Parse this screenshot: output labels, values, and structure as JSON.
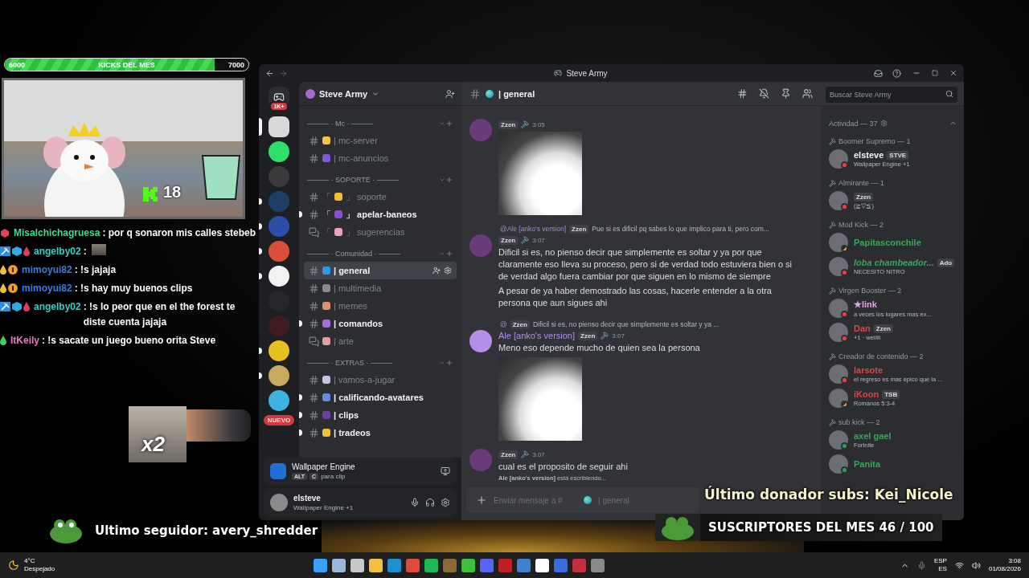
{
  "stream": {
    "goal": {
      "start": "6000",
      "title": "KICKS DEL MES",
      "end": "7000",
      "level": 0.86
    },
    "scene": {
      "counter": "18"
    },
    "chat": [
      {
        "badges": [
          {
            "kind": "gift"
          }
        ],
        "user": "Misalchichagruesa",
        "color": "#3ddc97",
        "text": ": por q sonaron mis calles stebeb",
        "attachment": false
      },
      {
        "badges": [
          {
            "kind": "pickaxe"
          },
          {
            "kind": "cube"
          },
          {
            "kind": "drop"
          }
        ],
        "user": "angelby02",
        "color": "#35d0c5",
        "text": ":",
        "attachment": true
      },
      {
        "badges": [
          {
            "kind": "flame"
          },
          {
            "kind": "coin"
          }
        ],
        "user": "mimoyui82",
        "color": "#3b7ddd",
        "text": ": !s jajaja",
        "attachment": false
      },
      {
        "badges": [
          {
            "kind": "flame"
          },
          {
            "kind": "coin"
          }
        ],
        "user": "mimoyui82",
        "color": "#3b7ddd",
        "text": ": !s hay muy buenos clips",
        "attachment": false
      },
      {
        "badges": [
          {
            "kind": "pickaxe"
          },
          {
            "kind": "cube"
          },
          {
            "kind": "drop"
          }
        ],
        "user": "angelby02",
        "color": "#35d0c5",
        "text": ": !s lo peor que en el the forest te diste cuenta jajaja",
        "attachment": false
      },
      {
        "badges": [
          {
            "kind": "leaf"
          }
        ],
        "user": "ItKeily",
        "color": "#e879c9",
        "text": ": !s sacate un juego bueno orita Steve",
        "attachment": false
      }
    ],
    "clip": {
      "label": "x2"
    },
    "follower": "Ultimo seguidor: avery_shredder",
    "donor": "Último donador subs: Kei_Nicole",
    "subs": "SUSCRIPTORES DEL MES 46 / 100"
  },
  "discord": {
    "window_title": "Steve Army",
    "home_badge": "1K+",
    "servers": [
      {
        "color": "#d9d9d9",
        "selected": true,
        "unread": false
      },
      {
        "color": "#2ee06b",
        "selected": false,
        "unread": false
      },
      {
        "color": "#3a3a3a",
        "selected": false,
        "unread": false
      },
      {
        "color": "#1d3f66",
        "selected": false,
        "unread": true
      },
      {
        "color": "#2b4fa8",
        "selected": false,
        "unread": true
      },
      {
        "color": "#d94f3a",
        "selected": false,
        "unread": true
      },
      {
        "color": "#f2f2f2",
        "selected": false,
        "unread": true
      },
      {
        "color": "#26262b",
        "selected": false,
        "unread": false
      },
      {
        "color": "#401c20",
        "selected": false,
        "unread": false
      },
      {
        "color": "#e8c020",
        "selected": false,
        "unread": true
      },
      {
        "color": "#c9a860",
        "selected": false,
        "unread": true
      },
      {
        "color": "#3fb3e0",
        "selected": false,
        "unread": false
      }
    ],
    "new_badge": "NUEVO",
    "server_name": "Steve Army",
    "categories": [
      {
        "name": "——— · Mc · ———",
        "channels": [
          {
            "kind": "text",
            "close": "|",
            "name": "mc-server",
            "unread": false,
            "selected": false
          },
          {
            "kind": "text",
            "close": "|",
            "name": "mc-anuncios",
            "unread": false,
            "selected": false
          }
        ]
      },
      {
        "name": "——— · SOPORTE · ———",
        "channels": [
          {
            "kind": "text",
            "open": "「",
            "close": "」",
            "name": "soporte",
            "unread": false,
            "selected": false
          },
          {
            "kind": "text",
            "open": "「",
            "close": "」",
            "name": "apelar-baneos",
            "unread": true,
            "selected": false
          },
          {
            "kind": "forum",
            "open": "「",
            "close": "」",
            "name": "sugerencias",
            "unread": false,
            "selected": false
          }
        ]
      },
      {
        "name": "——— · Comunidad · ———",
        "channels": [
          {
            "kind": "text",
            "close": "|",
            "name": "general",
            "unread": false,
            "selected": true
          },
          {
            "kind": "text",
            "close": "|",
            "name": "multimedia",
            "unread": false,
            "selected": false
          },
          {
            "kind": "text",
            "close": "|",
            "name": "memes",
            "unread": false,
            "selected": false
          },
          {
            "kind": "text",
            "close": "|",
            "name": "comandos",
            "unread": true,
            "selected": false
          },
          {
            "kind": "forum",
            "close": "|",
            "name": "arte",
            "unread": false,
            "selected": false
          }
        ]
      },
      {
        "name": "——— · EXTRAS · ———",
        "channels": [
          {
            "kind": "text",
            "close": "|",
            "name": "vamos-a-jugar",
            "unread": false,
            "selected": false
          },
          {
            "kind": "text",
            "close": "|",
            "name": "calificando-avatares",
            "unread": true,
            "selected": false
          },
          {
            "kind": "text",
            "close": "|",
            "name": "clips",
            "unread": true,
            "selected": false
          },
          {
            "kind": "text",
            "close": "|",
            "name": "tradeos",
            "unread": true,
            "selected": false
          }
        ]
      }
    ],
    "activity": {
      "app": "Wallpaper Engine",
      "keys": [
        "ALT",
        "C"
      ],
      "hint": "para clip"
    },
    "user": {
      "name": "elsteve",
      "status_text": "Wallpaper Engine +1"
    },
    "channel_title": "| general",
    "search": {
      "placeholder": "Buscar Steve Army"
    },
    "messages": [
      {
        "tag": "Zzen",
        "time": "3:05",
        "image": true
      },
      {
        "reply": {
          "to": "@Ale [anko's version]",
          "tag": "Zzen",
          "text": "Pue si es dificil pq sabes lo que implico para ti, pero com..."
        },
        "tag": "Zzen",
        "time": "3:07",
        "paragraphs": [
          "Dificil si es, no pienso decir que simplemente es soltar y ya por que claramente eso lleva su proceso, pero si de verdad todo estuviera bien o si de verdad algo fuera cambiar por que siguen en lo mismo de siempre",
          "A pesar de ya haber demostrado las cosas, hacerle entender a la otra persona que aun sigues ahi"
        ],
        "image": false
      },
      {
        "reply": {
          "to": "@",
          "tag": "Zzen",
          "text": "Dificil si es, no pienso decir que simplemente es soltar y ya ..."
        },
        "author": "Ale [anko's version]",
        "color": "#b48ee8",
        "tag": "Zzen",
        "time": "3:07",
        "paragraphs": [
          "Meno eso depende mucho de quien sea la persona"
        ],
        "image": true
      },
      {
        "tag": "Zzen",
        "time": "3:07",
        "paragraphs": [
          "cual es el proposito de seguir ahi"
        ],
        "image": false
      }
    ],
    "typing": "**Ale [anko's version]** está escribiendo...",
    "composer": {
      "placeholder": "Enviar mensaje a #",
      "channel": "| general"
    },
    "members_header": "Actividad — 37",
    "member_groups": [
      {
        "name": "Boomer Supremo — 1",
        "members": [
          {
            "name": "elsteve",
            "color": "#f2f3f5",
            "italic": false,
            "tag": "STVE",
            "sub": "Wallpaper Engine +1",
            "dnd": true,
            "idle": false
          }
        ]
      },
      {
        "name": "Almirante — 1",
        "members": [
          {
            "tag": "Zzen",
            "sub": "(≧▽≦)",
            "dnd": true,
            "idle": false
          }
        ]
      },
      {
        "name": "Mod Kick — 2",
        "members": [
          {
            "name": "Papitasconchile",
            "color": "#3ba55c",
            "italic": false,
            "dnd": false,
            "idle": true
          },
          {
            "name": "loba chambeador...",
            "color": "#3ba55c",
            "italic": true,
            "tag": "Ado",
            "sub": "NECESITO NITRO",
            "dnd": true,
            "idle": false
          }
        ]
      },
      {
        "name": "Virgen Booster — 2",
        "members": [
          {
            "name": "★link",
            "color": "#e6a0f0",
            "italic": false,
            "sub": "a veces los lugares mas ex...",
            "dnd": true,
            "idle": false
          },
          {
            "name": "Dan",
            "color": "#e04545",
            "italic": false,
            "tag": "Zzen",
            "sub": "+1 · weiiiii",
            "dnd": true,
            "idle": false
          }
        ]
      },
      {
        "name": "Creador de contenido — 2",
        "members": [
          {
            "name": "larsote",
            "color": "#e04545",
            "italic": false,
            "sub": "el regreso es mas epico que la ...",
            "dnd": true,
            "idle": false
          },
          {
            "name": "iKoon",
            "color": "#e04545",
            "italic": false,
            "tag": "TSB",
            "sub": "Romanos 5:3-4",
            "dnd": false,
            "idle": true
          }
        ]
      },
      {
        "name": "sub kick — 2",
        "members": [
          {
            "name": "axel gael",
            "color": "#3ba55c",
            "italic": false,
            "sub": "Fortnite",
            "dnd": false,
            "idle": false
          },
          {
            "name": "Panita",
            "color": "#3ba55c",
            "italic": false,
            "dnd": false,
            "idle": false
          }
        ]
      }
    ]
  },
  "taskbar": {
    "temperature": "4°C",
    "weather": "Despejado",
    "lang": "ESP",
    "layout": "ES",
    "time": "3:08",
    "date": "01/08/2026"
  }
}
